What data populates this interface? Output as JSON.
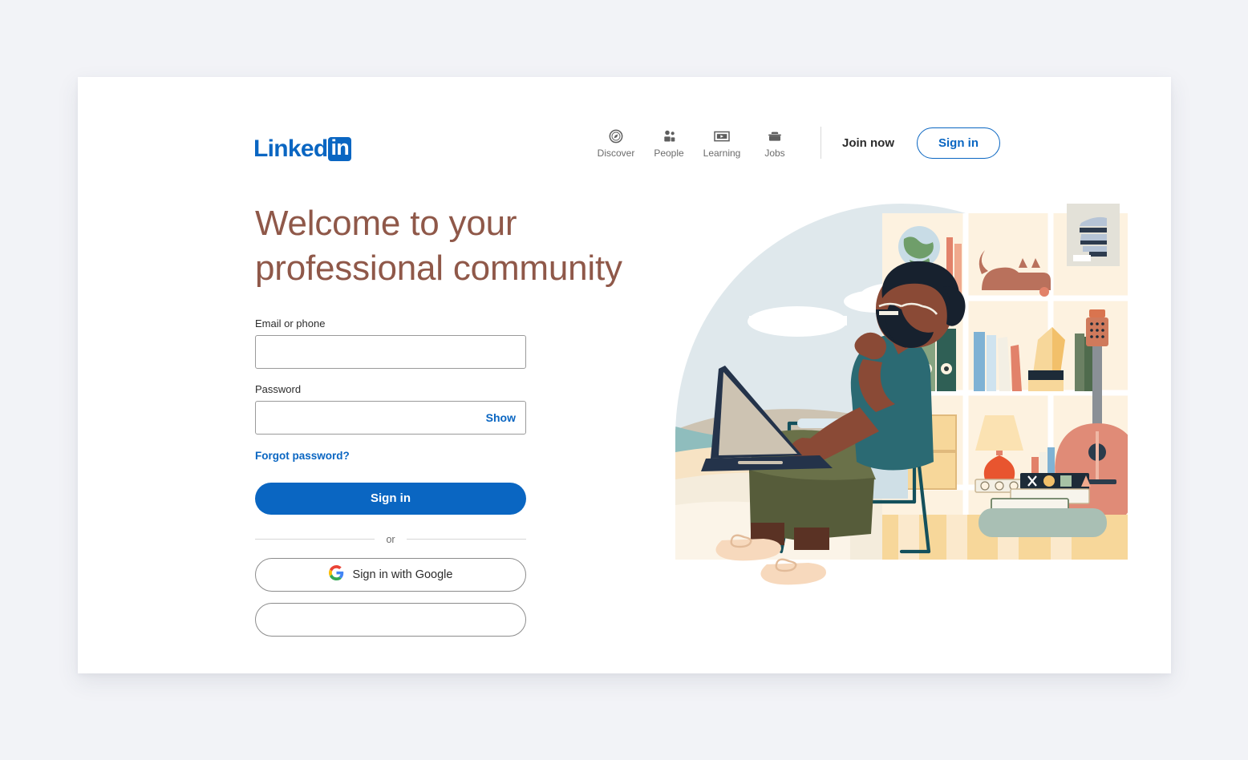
{
  "page": {
    "background_color": "#f2f3f7",
    "card_background": "#ffffff"
  },
  "brand": {
    "name": "Linked",
    "mark": "in",
    "color": "#0a66c2"
  },
  "nav": {
    "items": [
      {
        "label": "Discover",
        "icon": "compass-icon"
      },
      {
        "label": "People",
        "icon": "people-icon"
      },
      {
        "label": "Learning",
        "icon": "learning-icon"
      },
      {
        "label": "Jobs",
        "icon": "briefcase-icon"
      }
    ],
    "join_now": "Join now",
    "sign_in": "Sign in"
  },
  "hero": {
    "headline_line1": "Welcome to your",
    "headline_line2": "professional community",
    "headline_color": "#8f5849"
  },
  "form": {
    "email_label": "Email or phone",
    "email_value": "",
    "email_placeholder": "",
    "password_label": "Password",
    "password_value": "",
    "password_placeholder": "",
    "show_label": "Show",
    "forgot_password": "Forgot password?",
    "submit_label": "Sign in",
    "divider_label": "or",
    "google_label": "Sign in with Google",
    "google_icon": "google-g-icon",
    "accent_color": "#0a66c2"
  },
  "illustration": {
    "alt": "Person with glasses and beard sitting in a chair using a laptop, in front of a bookshelf with a globe, cat, books, lamp and guitar, with a beach landscape behind",
    "colors": {
      "sky": "#dfe8ec",
      "sand": "#f7e3c4",
      "water": "#8fbdbd",
      "shelf": "#fbeed8",
      "shirt": "#2b6a73",
      "pants": "#6a7149",
      "skin": "#8a4a36",
      "hair": "#17212e",
      "chair": "#cfdfe6",
      "chair_frame": "#14505c",
      "guitar": "#e08b77",
      "cat": "#b9715c"
    }
  }
}
